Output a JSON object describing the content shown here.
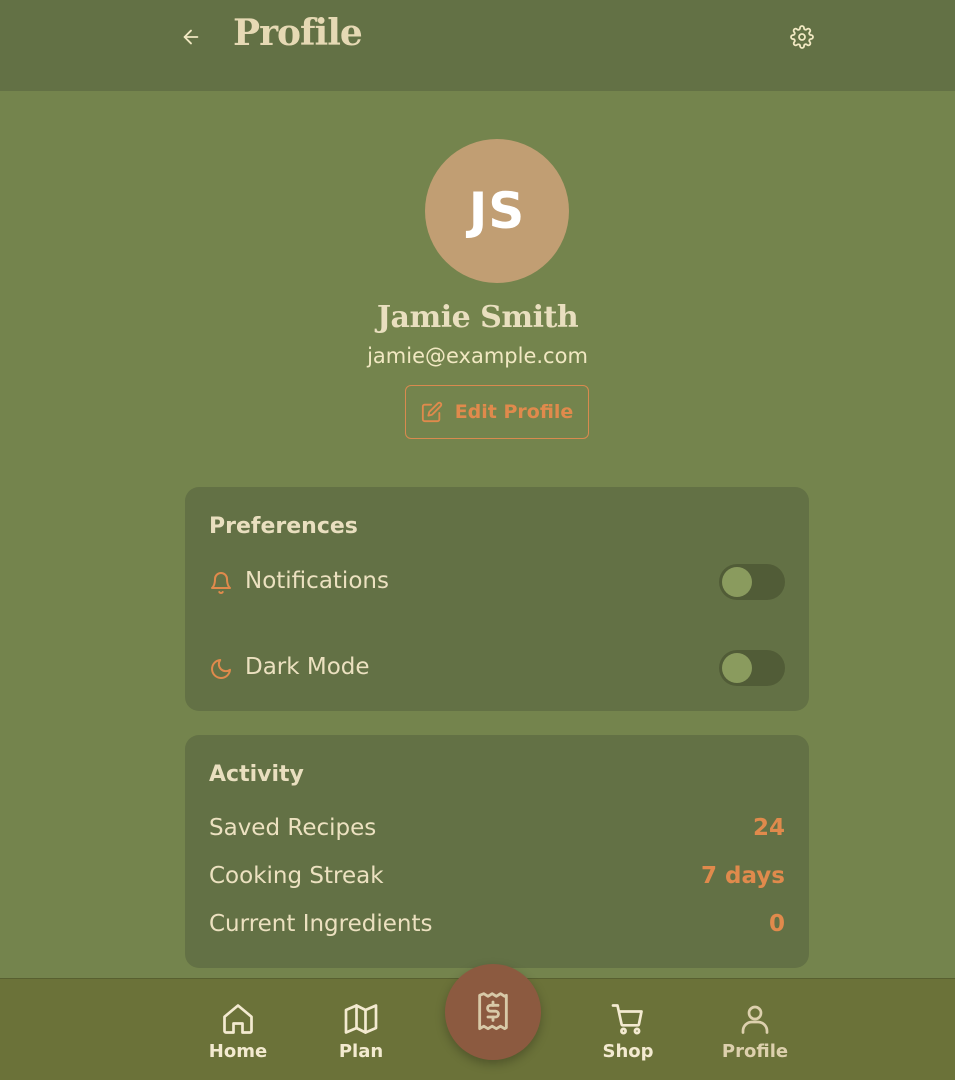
{
  "header": {
    "title": "Profile",
    "back_icon": "arrow-left-icon",
    "settings_icon": "gear-icon"
  },
  "profile": {
    "initials": "JS",
    "name": "Jamie Smith",
    "email": "jamie@example.com",
    "edit_label": "Edit Profile",
    "edit_icon": "pencil-square-icon"
  },
  "preferences": {
    "title": "Preferences",
    "items": [
      {
        "label": "Notifications",
        "icon": "bell-icon",
        "enabled": false
      },
      {
        "label": "Dark Mode",
        "icon": "moon-icon",
        "enabled": false
      }
    ]
  },
  "activity": {
    "title": "Activity",
    "stats": [
      {
        "label": "Saved Recipes",
        "value": "24"
      },
      {
        "label": "Cooking Streak",
        "value": "7 days"
      },
      {
        "label": "Current Ingredients",
        "value": "0"
      }
    ]
  },
  "nav": {
    "items": [
      {
        "label": "Home",
        "icon": "home-icon"
      },
      {
        "label": "Plan",
        "icon": "map-icon"
      },
      {
        "label": "Shop",
        "icon": "cart-icon"
      },
      {
        "label": "Profile",
        "icon": "user-icon",
        "active": true
      }
    ],
    "fab_icon": "receipt-dollar-icon"
  },
  "colors": {
    "background": "#74844d",
    "header": "#637145",
    "card": "#637145",
    "accent": "#e08a4c",
    "avatar": "#c19e73",
    "nav": "#6b7239",
    "fab": "#8c5a40"
  }
}
